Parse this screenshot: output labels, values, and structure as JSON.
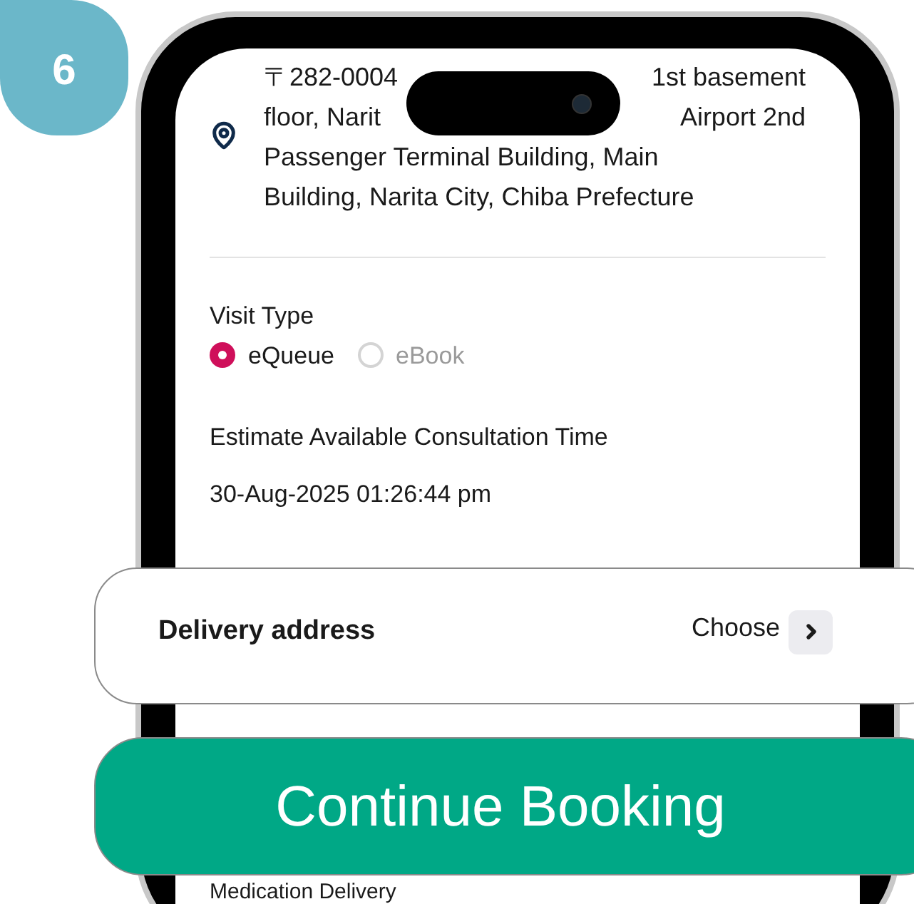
{
  "step_badge": "6",
  "address": {
    "line_1_start": "〒282-0004",
    "line_1_end": "1st basement",
    "line_2_start": "floor, Narit",
    "line_2_end": "Airport 2nd",
    "line_3": "Passenger Terminal Building, Main",
    "line_4": "Building, Narita City, Chiba Prefecture"
  },
  "visit_type": {
    "label": "Visit Type",
    "options": [
      {
        "label": "eQueue",
        "selected": true,
        "disabled": false
      },
      {
        "label": "eBook",
        "selected": false,
        "disabled": true
      }
    ]
  },
  "estimate": {
    "label": "Estimate Available Consultation Time",
    "value": "30-Aug-2025 01:26:44 pm"
  },
  "delivery_address": {
    "label": "Delivery address",
    "action": "Choose"
  },
  "continue_button": "Continue Booking",
  "section_below": "Medication Delivery"
}
